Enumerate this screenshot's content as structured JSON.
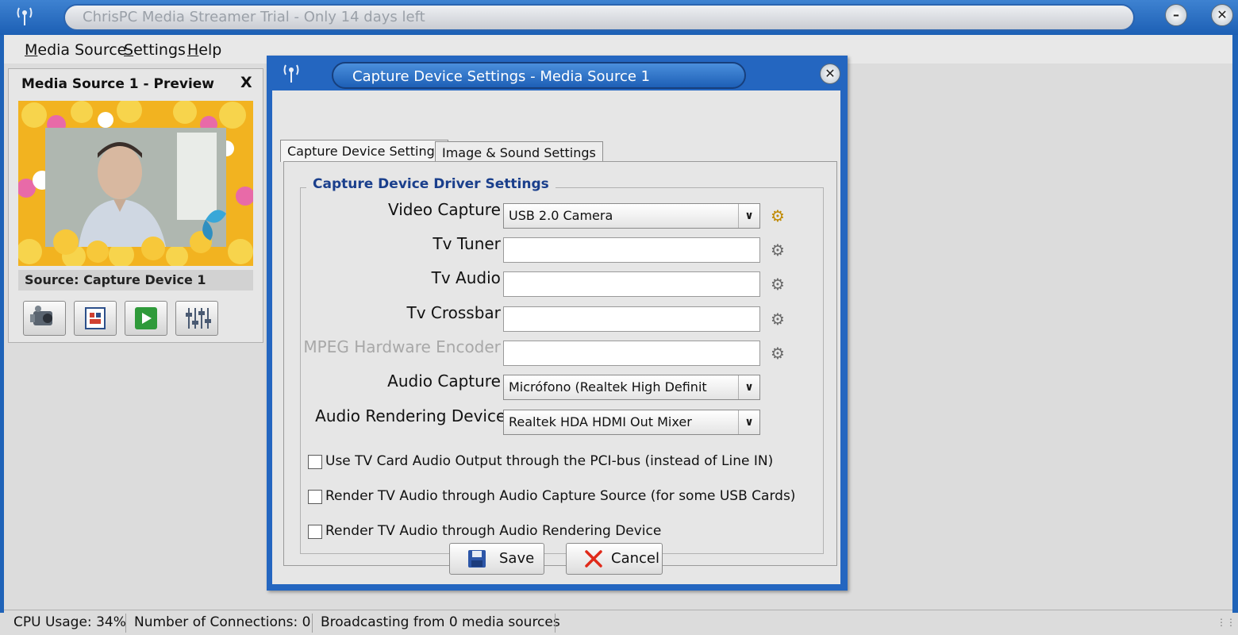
{
  "app": {
    "title": "ChrisPC Media Streamer Trial - Only 14 days left"
  },
  "menu": {
    "items": [
      {
        "first": "M",
        "rest": "edia Source"
      },
      {
        "first": "S",
        "rest": "ettings"
      },
      {
        "first": "H",
        "rest": "elp"
      }
    ]
  },
  "preview": {
    "title": "Media Source 1 - Preview",
    "close": "X",
    "source": "Source: Capture Device 1"
  },
  "dialog": {
    "title": "Capture Device Settings - Media Source 1",
    "tabs": [
      "Capture Device Settings",
      "Image & Sound Settings"
    ],
    "group_title": "Capture Device Driver Settings",
    "labels": {
      "video_capture": "Video Capture :",
      "tv_tuner": "Tv Tuner :",
      "tv_audio": "Tv Audio :",
      "tv_crossbar": "Tv Crossbar :",
      "mpeg_encoder": "MPEG Hardware Encoder :",
      "audio_capture": "Audio Capture :",
      "audio_rendering": "Audio Rendering  Device:"
    },
    "values": {
      "video_capture": "USB 2.0 Camera",
      "tv_tuner": "",
      "tv_audio": "",
      "tv_crossbar": "",
      "mpeg_encoder": "",
      "audio_capture": "Micrófono (Realtek High Definit",
      "audio_rendering": "Realtek HDA HDMI Out Mixer"
    },
    "checkboxes": [
      "Use TV Card Audio Output through the PCI-bus (instead of Line IN)",
      "Render TV Audio through Audio Capture Source (for some USB Cards)",
      "Render TV Audio through Audio Rendering Device"
    ],
    "save": "Save",
    "cancel": "Cancel"
  },
  "status": {
    "cpu": "CPU Usage: 34%",
    "connections": "Number of Connections: 0",
    "broadcasting": "Broadcasting from 0 media sources"
  }
}
